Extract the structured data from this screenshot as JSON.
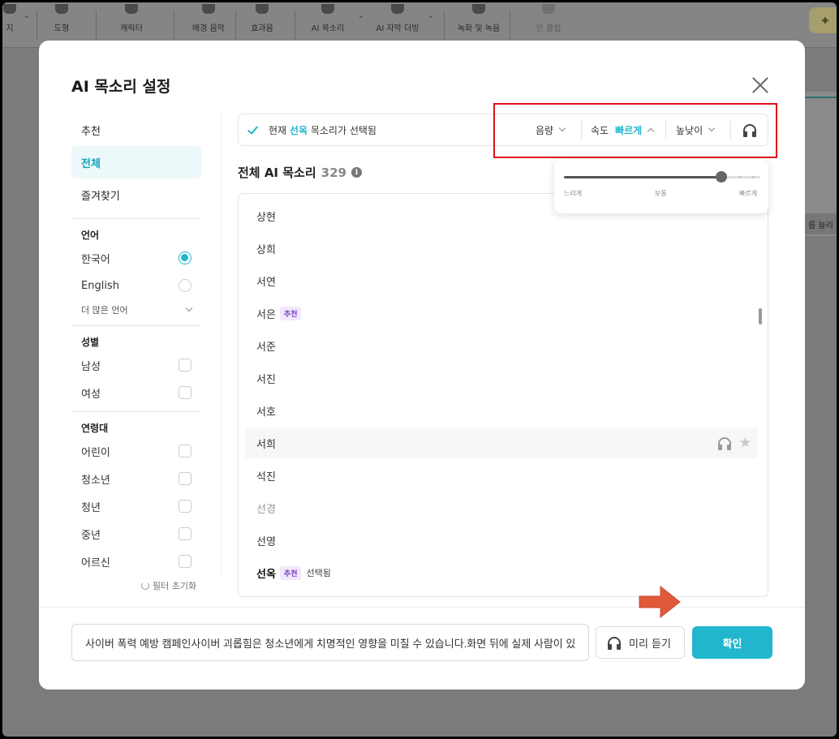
{
  "toolbar": {
    "items": [
      "지",
      "도형",
      "캐릭터",
      "배경 음악",
      "효과음",
      "AI 목소리",
      "AI 자막 더빙",
      "녹화 및 녹음",
      "빈 클립"
    ],
    "star_glyph": "✦"
  },
  "background": {
    "partial_button": "름 늘리"
  },
  "modal": {
    "title": "AI 목소리 설정",
    "nav": [
      "추천",
      "전체",
      "즐겨찾기"
    ],
    "active_nav": "전체",
    "filters": {
      "language": {
        "heading": "언어",
        "options": [
          "한국어",
          "English"
        ],
        "selected": "한국어",
        "more": "더 많은 언어"
      },
      "gender": {
        "heading": "성별",
        "options": [
          "남성",
          "여성"
        ]
      },
      "age": {
        "heading": "연령대",
        "options": [
          "어린이",
          "청소년",
          "청년",
          "중년",
          "어르신"
        ]
      },
      "reset": "필터 초기화"
    },
    "status": {
      "prefix": "현재",
      "voice": "선옥",
      "suffix": "목소리가 선택됨"
    },
    "controls": {
      "volume": "음량",
      "speed_label": "속도",
      "speed_value": "빠르게",
      "pitch": "높낮이"
    },
    "speed_slider": {
      "min_label": "느리게",
      "mid_label": "보통",
      "max_label": "빠르게",
      "level_percent": 80
    },
    "list": {
      "title": "전체 AI 목소리",
      "count": "329",
      "items": [
        {
          "name": "상현"
        },
        {
          "name": "상희"
        },
        {
          "name": "서연"
        },
        {
          "name": "서은",
          "badge": "추천"
        },
        {
          "name": "서준"
        },
        {
          "name": "서진"
        },
        {
          "name": "서호"
        },
        {
          "name": "서희",
          "hover": true
        },
        {
          "name": "석진"
        },
        {
          "name": "선경",
          "grey": true
        },
        {
          "name": "선영"
        },
        {
          "name": "선옥",
          "badge": "추천",
          "selected_text": "선택됨",
          "selected": true
        }
      ]
    },
    "footer": {
      "input_value": "사이버 폭력 예방 캠페인사이버 괴롭힘은 청소년에게 치명적인 영향을 미칠 수 있습니다.화면 뒤에 실제 사람이 있",
      "preview": "미리 듣기",
      "confirm": "확인"
    }
  },
  "colors": {
    "accent": "#21b6cd",
    "highlight_border": "#e0111b",
    "arrow": "#e05a3a",
    "badge": "#7a3fc4"
  }
}
